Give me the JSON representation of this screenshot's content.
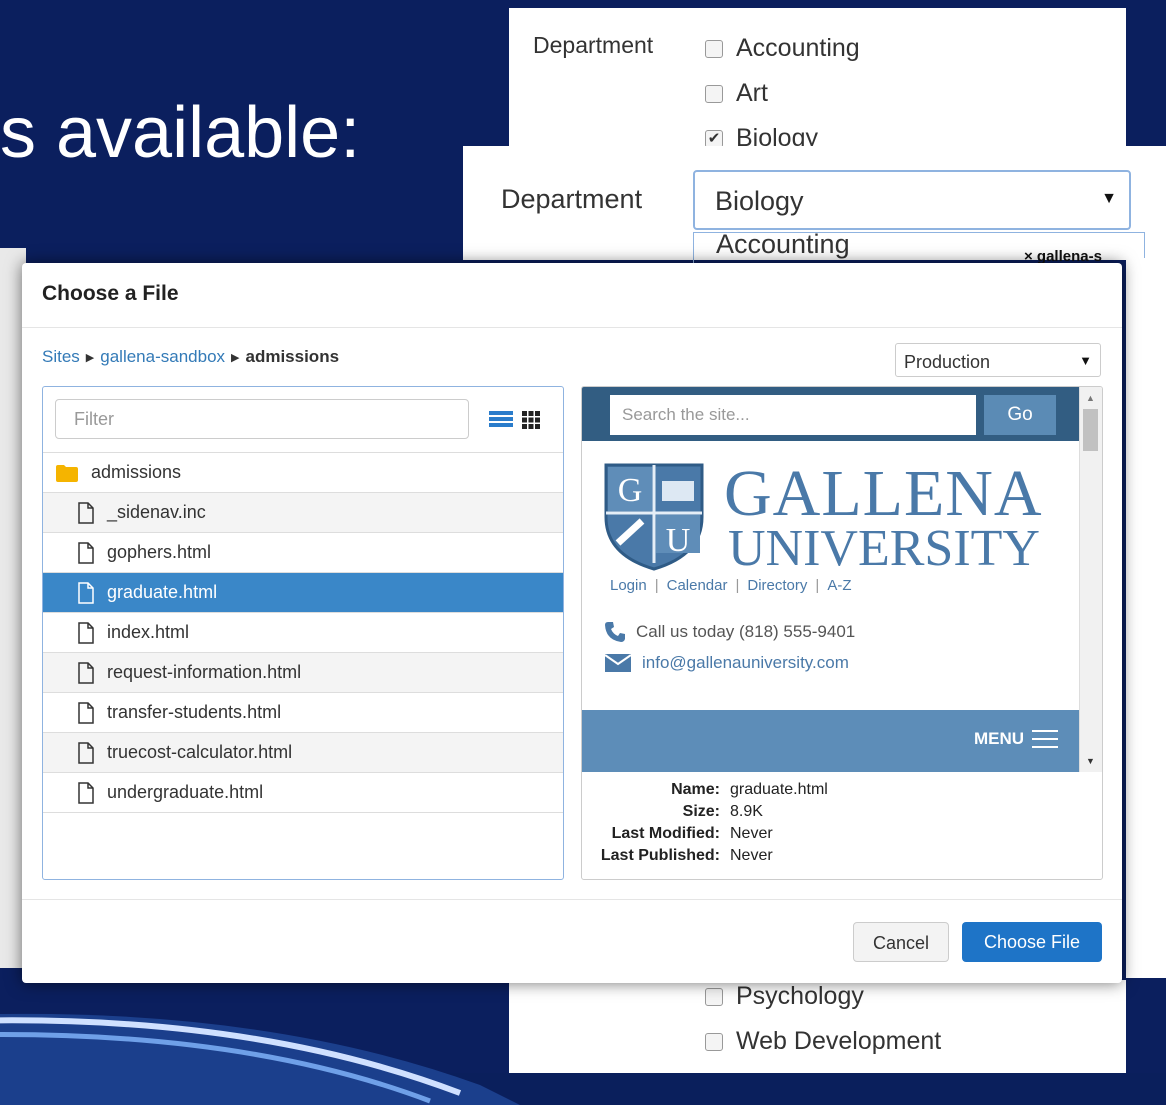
{
  "slide": {
    "heading": "s available:",
    "brace": ")"
  },
  "department_checkboxes": {
    "label": "Department",
    "options": [
      {
        "label": "Accounting",
        "checked": false
      },
      {
        "label": "Art",
        "checked": false
      },
      {
        "label": "Biology",
        "checked": true
      }
    ],
    "more_options": [
      {
        "label": "Psychology",
        "checked": false
      },
      {
        "label": "Web Development",
        "checked": false
      }
    ]
  },
  "department_select": {
    "label": "Department",
    "value": "Biology",
    "open_option": "Accounting",
    "behind_chip": "× gallena-s"
  },
  "dialog": {
    "title": "Choose a File",
    "breadcrumb": [
      "Sites",
      "gallena-sandbox",
      "admissions"
    ],
    "environment": "Production",
    "filter_placeholder": "Filter",
    "folder": "admissions",
    "files": [
      "_sidenav.inc",
      "gophers.html",
      "graduate.html",
      "index.html",
      "request-information.html",
      "transfer-students.html",
      "truecost-calculator.html",
      "undergraduate.html"
    ],
    "selected_file": "graduate.html",
    "cancel_label": "Cancel",
    "choose_label": "Choose File"
  },
  "preview": {
    "search_placeholder": "Search the site...",
    "go_label": "Go",
    "crest_letters": [
      "G",
      "U"
    ],
    "name_line1": "GALLENA",
    "name_line2": "UNIVERSITY",
    "links": [
      "Login",
      "Calendar",
      "Directory",
      "A-Z"
    ],
    "phone": "Call us today (818) 555-9401",
    "email": "info@gallenauniversity.com",
    "menu_label": "MENU",
    "colors": {
      "topbar": "#325d82",
      "brand": "#4a79a8",
      "menubar": "#5d8db8"
    }
  },
  "file_info": {
    "name_label": "Name:",
    "name": "graduate.html",
    "size_label": "Size:",
    "size": "8.9K",
    "modified_label": "Last Modified:",
    "modified": "Never",
    "published_label": "Last Published:",
    "published": "Never"
  }
}
